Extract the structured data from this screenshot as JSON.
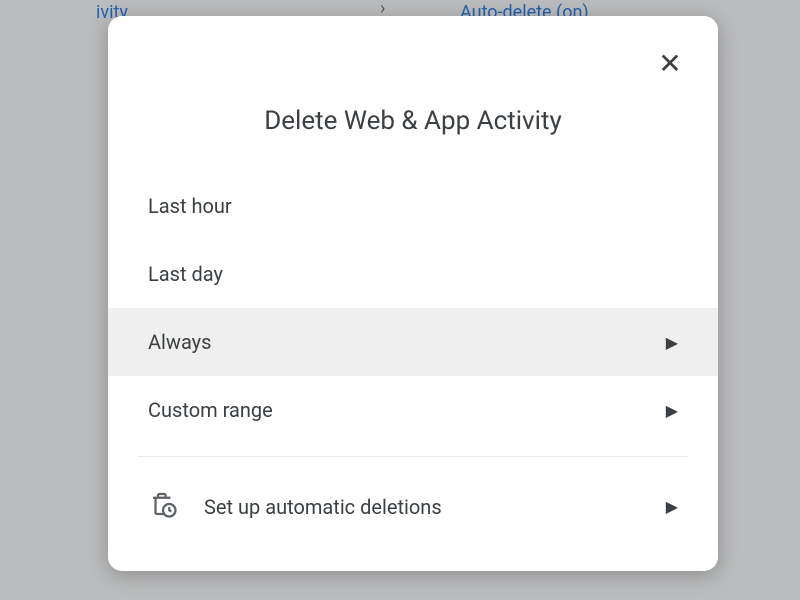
{
  "background": {
    "left_text": "ivity",
    "right_text": "Auto-delete (on)",
    "chevron": "›"
  },
  "modal": {
    "title": "Delete Web & App Activity",
    "close_aria": "Close",
    "options": [
      {
        "label": "Last hour",
        "has_chevron": false,
        "highlighted": false
      },
      {
        "label": "Last day",
        "has_chevron": false,
        "highlighted": false
      },
      {
        "label": "Always",
        "has_chevron": true,
        "highlighted": true
      },
      {
        "label": "Custom range",
        "has_chevron": true,
        "highlighted": false
      }
    ],
    "auto_delete": {
      "label": "Set up automatic deletions",
      "has_chevron": true
    }
  }
}
